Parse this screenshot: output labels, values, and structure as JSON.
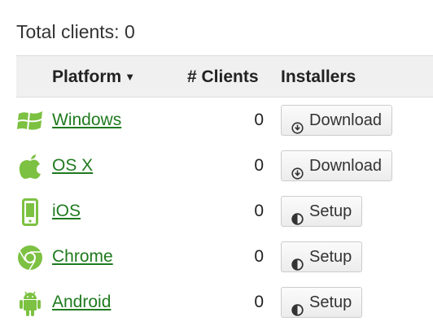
{
  "summary": {
    "total_label": "Total clients: 0"
  },
  "table": {
    "headers": {
      "platform": "Platform",
      "sort_indicator": "▼",
      "clients": "# Clients",
      "installers": "Installers"
    },
    "rows": [
      {
        "platform": "Windows",
        "icon": "windows-icon",
        "clients": "0",
        "action": "Download",
        "action_icon": "download-icon"
      },
      {
        "platform": "OS X",
        "icon": "apple-icon",
        "clients": "0",
        "action": "Download",
        "action_icon": "download-icon"
      },
      {
        "platform": "iOS",
        "icon": "phone-icon",
        "clients": "0",
        "action": "Setup",
        "action_icon": "half-circle-icon"
      },
      {
        "platform": "Chrome",
        "icon": "chrome-icon",
        "clients": "0",
        "action": "Setup",
        "action_icon": "half-circle-icon"
      },
      {
        "platform": "Android",
        "icon": "android-icon",
        "clients": "0",
        "action": "Setup",
        "action_icon": "half-circle-icon"
      }
    ]
  },
  "colors": {
    "icon_green": "#7cc142",
    "link_green": "#1f7a1f",
    "header_bg": "#f0f0f0"
  }
}
